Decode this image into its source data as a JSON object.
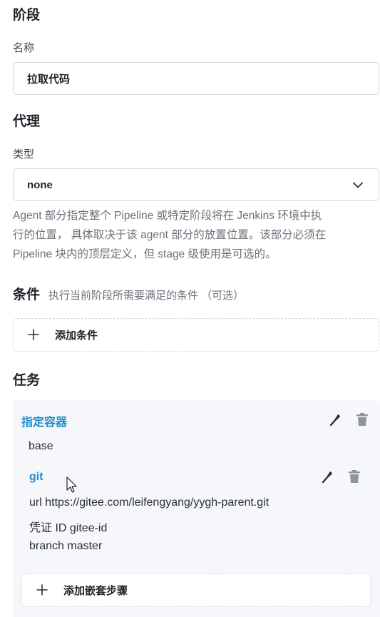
{
  "stage": {
    "heading": "阶段",
    "name_label": "名称",
    "name_value": "拉取代码"
  },
  "agent": {
    "heading": "代理",
    "type_label": "类型",
    "type_value": "none",
    "description_lines": [
      "Agent 部分指定整个 Pipeline 或特定阶段将在 Jenkins 环境中执",
      "行的位置， 具体取决于该 agent 部分的放置位置。该部分必须在",
      "Pipeline 块内的顶层定义，但 stage 级使用是可选的。"
    ]
  },
  "conditions": {
    "heading": "条件",
    "hint": "执行当前阶段所需要满足的条件 （可选）",
    "add_label": "添加条件"
  },
  "tasks": {
    "heading": "任务",
    "container": {
      "title": "指定容器",
      "name": "base"
    },
    "git": {
      "title": "git",
      "url_line": "url   https://gitee.com/leifengyang/yygh-parent.git",
      "credential_line": "凭证 ID   gitee-id",
      "branch_line": "branch   master"
    },
    "add_nested_label": "添加嵌套步骤"
  },
  "icons": {
    "edit": "wrench-icon",
    "delete": "trash-icon",
    "dropdown": "chevron-down-icon",
    "add": "plus-icon",
    "cursor": "mouse-pointer-icon"
  },
  "colors": {
    "accent": "#1f8dc6",
    "card_bg": "#f5f7fa"
  }
}
